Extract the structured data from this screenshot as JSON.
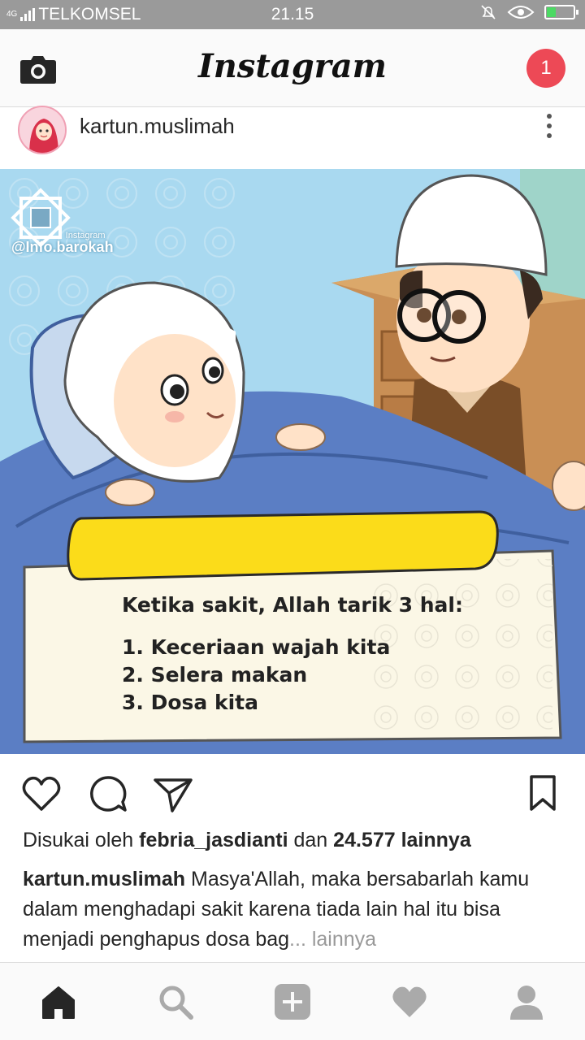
{
  "status_bar": {
    "network": "4G",
    "carrier": "TELKOMSEL",
    "time": "21.15",
    "battery_level": 0.35
  },
  "header": {
    "logo": "Instagram",
    "notification_count": "1",
    "icons": {
      "left": "camera-icon"
    }
  },
  "post": {
    "username": "kartun.muslimah",
    "image": {
      "watermark_small": "Instagram",
      "watermark_handle": "@Info.barokah",
      "card_heading": "Ketika sakit, Allah tarik 3 hal:",
      "card_items": [
        "1. Keceriaan wajah kita",
        "2. Selera makan",
        "3. Dosa kita"
      ]
    },
    "actions": {
      "like": "heart-icon",
      "comment": "comment-icon",
      "share": "send-icon",
      "save": "bookmark-icon"
    },
    "likes": {
      "prefix": "Disukai oleh",
      "user": "febria_jasdianti",
      "middle": "dan",
      "count": "24.577 lainnya"
    },
    "caption": {
      "author": "kartun.muslimah",
      "text": "Masya'Allah, maka bersabarlah kamu dalam menghadapi sakit karena tiada lain hal itu bisa menjadi penghapus dosa bag",
      "ellipsis": "...",
      "more": "lainnya"
    }
  },
  "bottom_nav": [
    "home-icon",
    "search-icon",
    "add-icon",
    "activity-heart-icon",
    "profile-icon"
  ],
  "colors": {
    "accent": "#ed4956",
    "status_bar": "#9a9a9a",
    "card_yellow": "#fbdc1a"
  }
}
